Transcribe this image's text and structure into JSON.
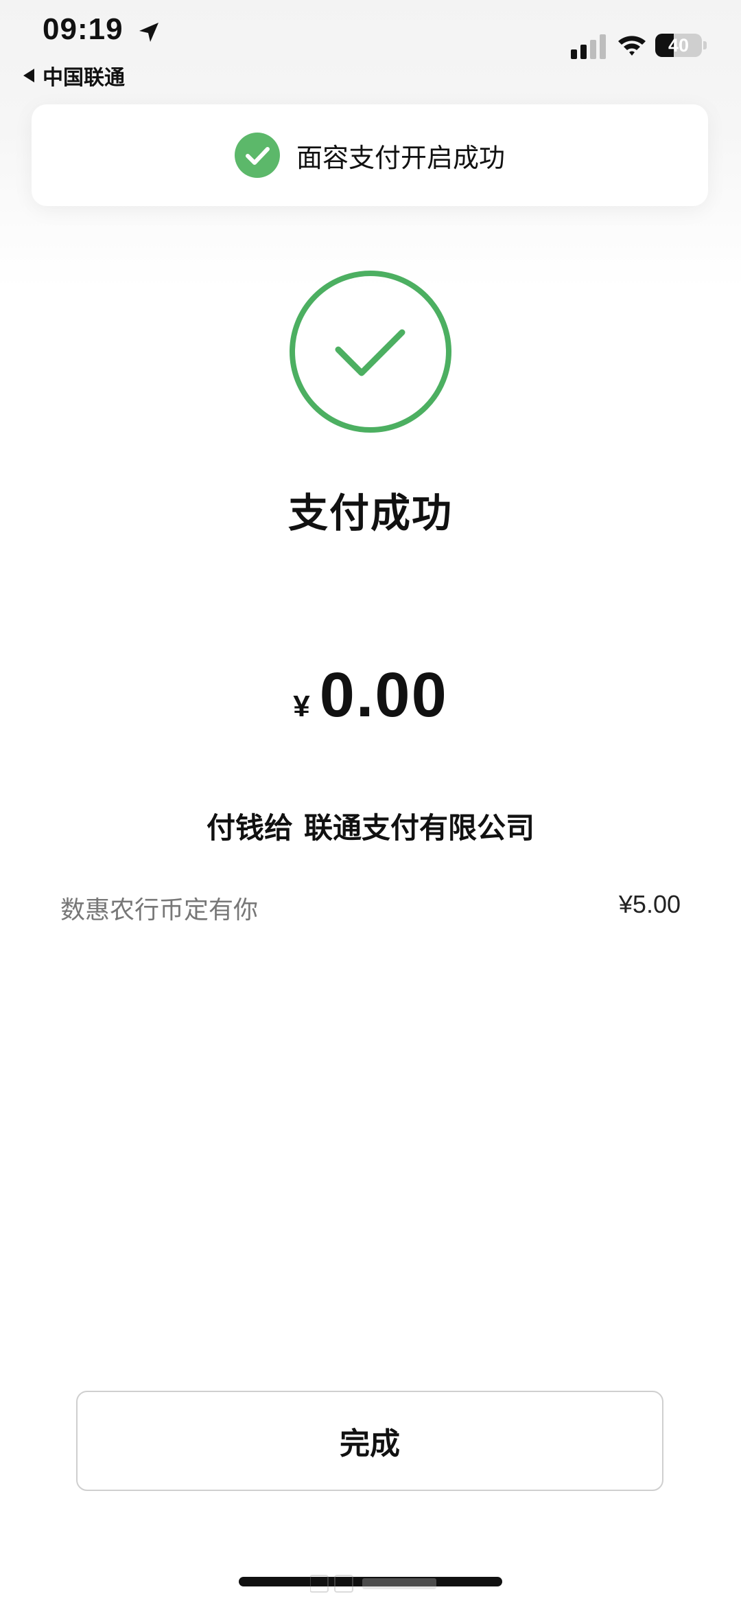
{
  "status_bar": {
    "time": "09:19",
    "back_label": "中国联通",
    "battery": "40",
    "battery_level": 0.4
  },
  "toast": {
    "text": "面容支付开启成功"
  },
  "result": {
    "title": "支付成功",
    "currency": "¥",
    "amount": "0.00",
    "payee_label": "付钱给",
    "payee_name": "联通支付有限公司"
  },
  "discount": {
    "name": "数惠农行币定有你",
    "value": "¥5.00"
  },
  "actions": {
    "done_label": "完成"
  },
  "colors": {
    "success_green": "#4caf61",
    "text": "#111111",
    "muted": "#777777"
  },
  "icons": {
    "location": "location-arrow-icon",
    "signal": "cellular-signal-icon",
    "wifi": "wifi-icon",
    "battery": "battery-icon",
    "toast_check": "check-circle-icon",
    "success": "success-check-icon"
  }
}
